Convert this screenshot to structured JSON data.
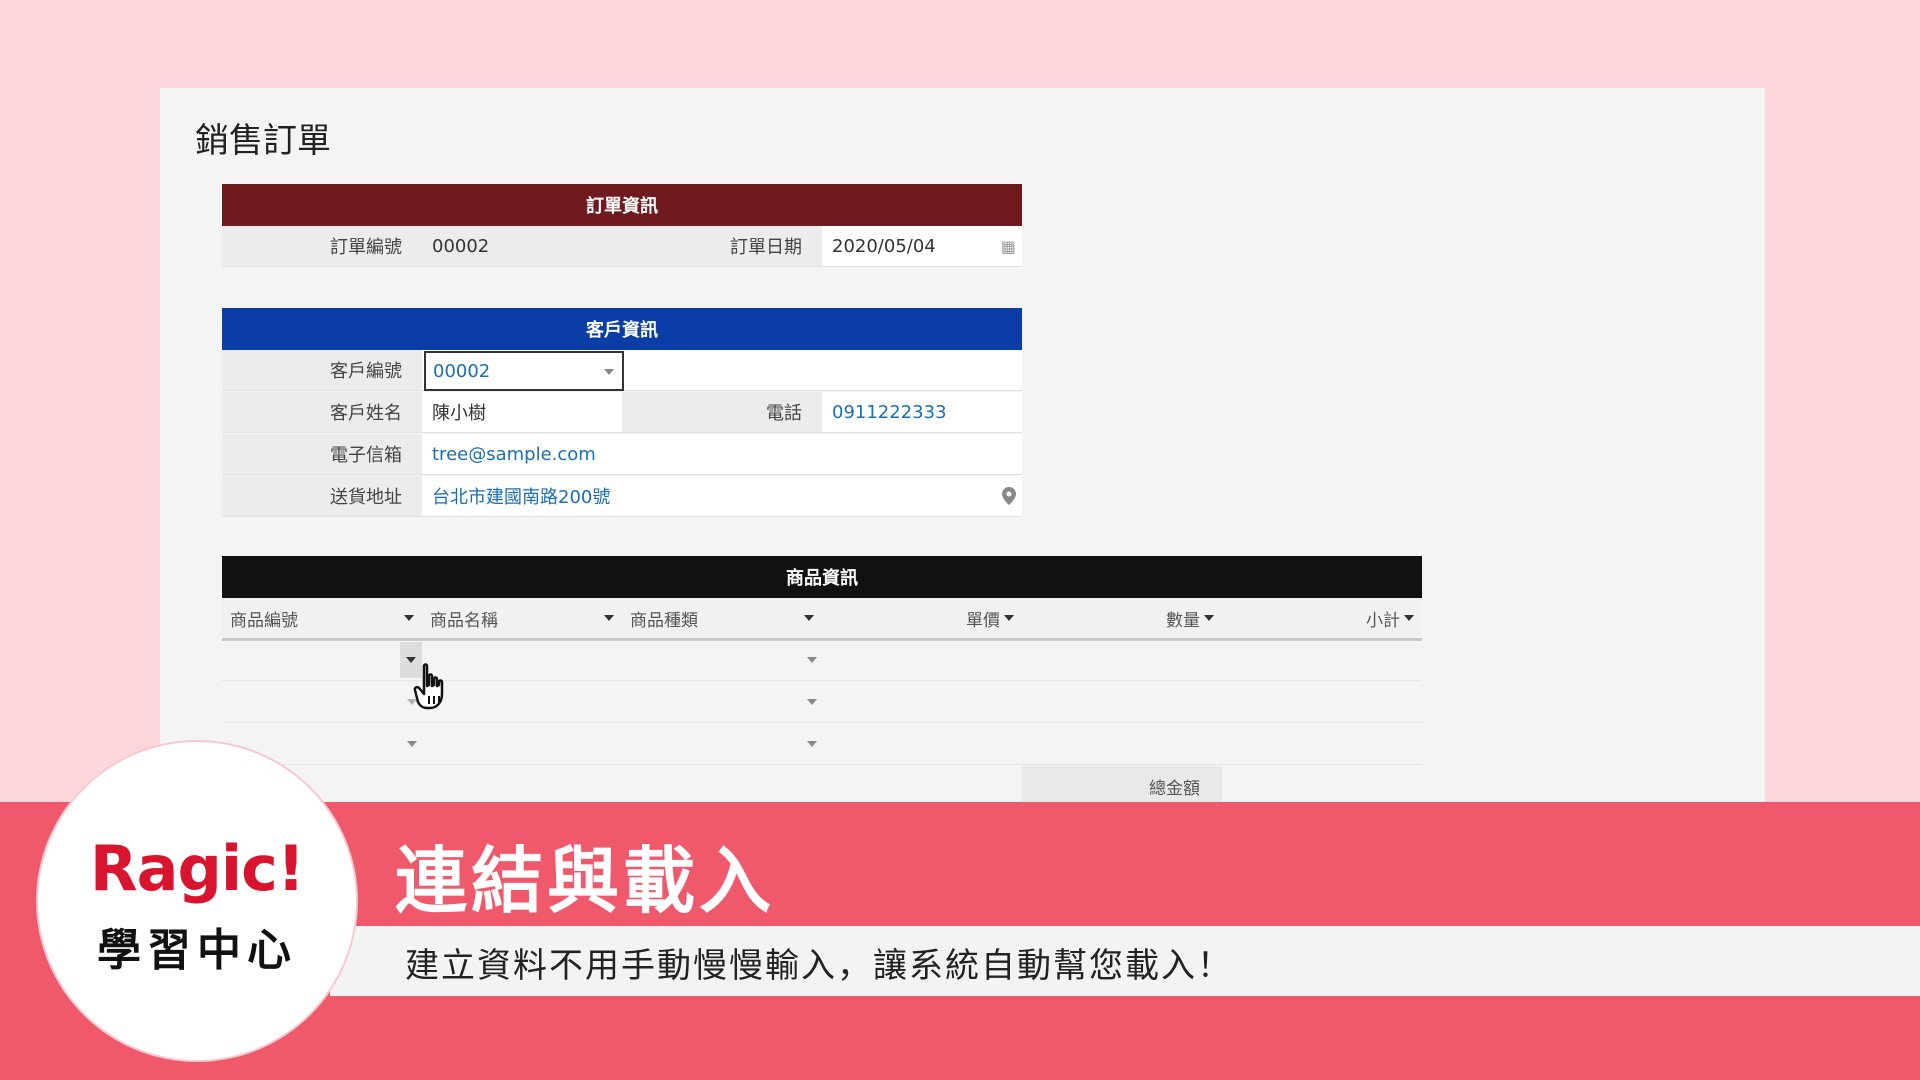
{
  "page_title": "銷售訂單",
  "order_section": {
    "header": "訂單資訊",
    "header_color": "#6e1a1f",
    "order_no_label": "訂單編號",
    "order_no_value": "00002",
    "order_date_label": "訂單日期",
    "order_date_value": "2020/05/04",
    "calendar_icon": "calendar-icon"
  },
  "customer_section": {
    "header": "客戶資訊",
    "header_color": "#0a3ea6",
    "customer_no_label": "客戶編號",
    "customer_no_value": "00002",
    "customer_name_label": "客戶姓名",
    "customer_name_value": "陳小樹",
    "phone_label": "電話",
    "phone_value": "0911222333",
    "email_label": "電子信箱",
    "email_value": "tree@sample.com",
    "address_label": "送貨地址",
    "address_value": "台北市建國南路200號",
    "map_pin_icon": "map-pin-icon"
  },
  "product_section": {
    "header": "商品資訊",
    "header_color": "#111111",
    "columns": [
      "商品編號",
      "商品名稱",
      "商品種類",
      "單價",
      "數量",
      "小計"
    ],
    "total_label": "總金額"
  },
  "banner": {
    "logo_name": "Ragic!",
    "logo_sub": "學習中心",
    "title": "連結與載入",
    "subtitle": "建立資料不用手動慢慢輸入，讓系統自動幫您載入！",
    "accent_color": "#f0586c",
    "background_color": "#fdd7dc"
  }
}
